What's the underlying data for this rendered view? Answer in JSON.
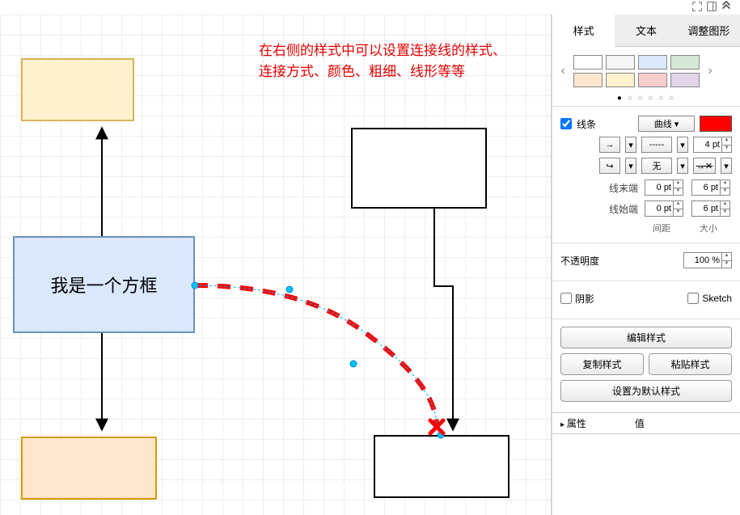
{
  "annotation": {
    "line1": "在右侧的样式中可以设置连接线的样式、",
    "line2": "连接方式、颜色、粗细、线形等等"
  },
  "shapes": {
    "blue_label": "我是一个方框"
  },
  "topbar": {
    "icon1": "fullscreen-icon",
    "icon2": "collapse-icon",
    "icon3": "chevron-up-icon"
  },
  "panel": {
    "tabs": {
      "style": "样式",
      "text": "文本",
      "arrange": "调整图形"
    },
    "fills": [
      "#ffffff",
      "#f5f5f5",
      "#dae8fc",
      "#d5e8d4",
      "#ffe6cc",
      "#fff2cc",
      "#f8cecc",
      "#e1d5e7"
    ],
    "line": {
      "checkbox_label": "线条",
      "curve_option": "曲线",
      "color": "#ff0000",
      "width_value": "4 pt",
      "arrow_start": "→",
      "dash_style": "-----",
      "waypoint": "↪",
      "none": "无",
      "scissors": "✂"
    },
    "ends": {
      "end_label": "线末端",
      "end_spacing": "0 pt",
      "end_size": "6 pt",
      "start_label": "线始端",
      "start_spacing": "0 pt",
      "start_size": "6 pt",
      "col1": "间距",
      "col2": "大小"
    },
    "opacity": {
      "label": "不透明度",
      "value": "100 %"
    },
    "shadow_label": "阴影",
    "sketch_label": "Sketch",
    "buttons": {
      "edit": "编辑样式",
      "copy": "复制样式",
      "paste": "粘贴样式",
      "default": "设置为默认样式"
    },
    "props": {
      "col1": "属性",
      "col2": "值"
    }
  }
}
